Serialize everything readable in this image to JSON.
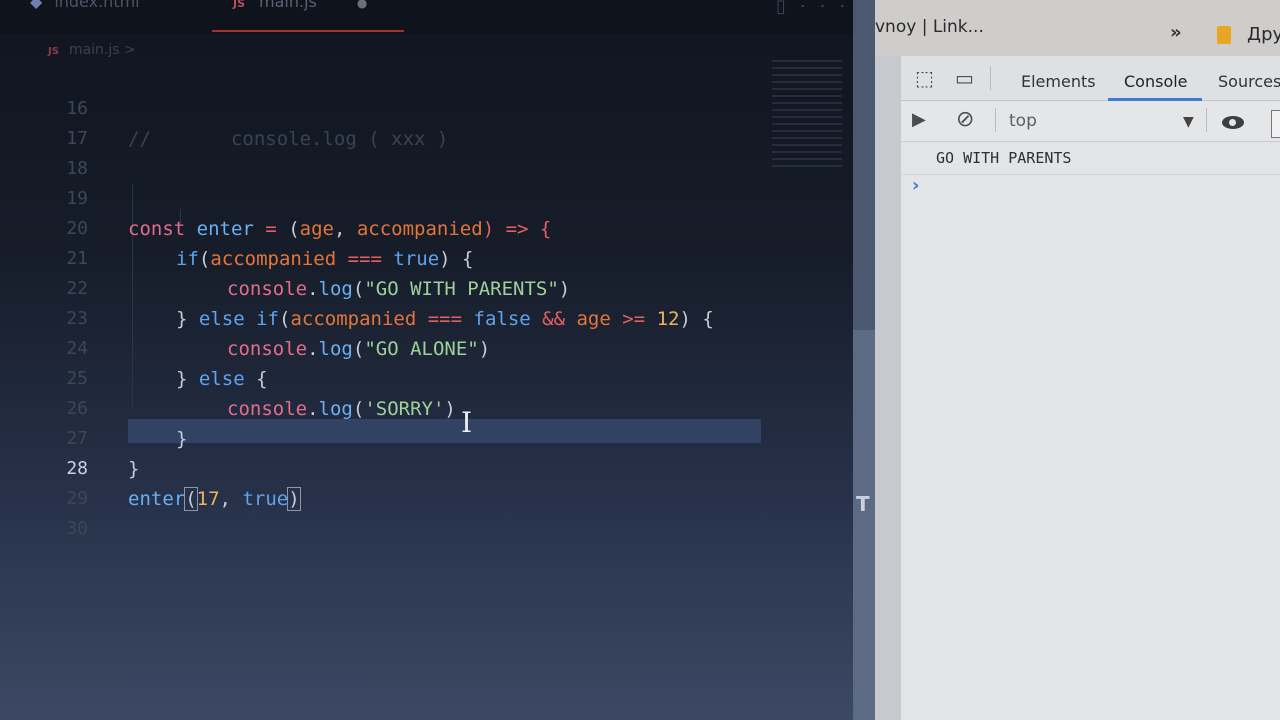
{
  "editor": {
    "tabs": [
      {
        "label": "index.html"
      },
      {
        "label": "main.js",
        "file_icon": "JS",
        "modified_indicator": "●"
      }
    ],
    "breadcrumb": {
      "file_icon": "JS",
      "label": "main.js >"
    },
    "toolbar_icons": {
      "split": "▯",
      "more": "···"
    },
    "current_line": "28",
    "lines": [
      {
        "n": "16",
        "text": "//       console.log ( xxx )"
      },
      {
        "n": "17",
        "text": ""
      },
      {
        "n": "18",
        "text": ""
      },
      {
        "n": "19",
        "text": "const enter = (age, accompanied) => {"
      },
      {
        "n": "20",
        "text": "    if(accompanied === true) {"
      },
      {
        "n": "21",
        "text": "        console.log(\"GO WITH PARENTS\")"
      },
      {
        "n": "22",
        "text": "    } else if(accompanied === false && age >= 12) {"
      },
      {
        "n": "23",
        "text": "        console.log(\"GO ALONE\")"
      },
      {
        "n": "24",
        "text": "    } else {"
      },
      {
        "n": "25",
        "text": "        console.log('SORRY')"
      },
      {
        "n": "26",
        "text": "    }"
      },
      {
        "n": "27",
        "text": "}"
      },
      {
        "n": "28",
        "text": "enter(17, true)"
      },
      {
        "n": "29",
        "text": ""
      },
      {
        "n": "30",
        "text": ""
      }
    ],
    "tokens": {
      "const": "const",
      "enter": "enter",
      "eq": " = ",
      "lp": "(",
      "age": "age",
      "comma": ", ",
      "accompanied": "accompanied",
      "arrow_open": ") => {",
      "if": "if",
      "strict_eq": " === ",
      "true": "true",
      "rp_brace": ") {",
      "console": "console",
      "dot_log": ".log",
      "log": "log",
      "dot": ".",
      "s_parents": "\"GO WITH PARENTS\"",
      "rp": ")",
      "close_else": "} ",
      "else": "else",
      "space": " ",
      "false": "false",
      "and": " && ",
      "gte": " >= ",
      "twelve": "12",
      "s_alone": "\"GO ALONE\"",
      "brace_open": " {",
      "s_sorry": "'SORRY'",
      "brace_close": "}",
      "seventeen": "17",
      "comment": "//       console.log ( xxx )"
    },
    "colors": {
      "keyword": "#5fa3ee",
      "string": "#9fd19a",
      "number": "#f0b35a",
      "param": "#e4753a",
      "const": "#e46d8b"
    }
  },
  "browser": {
    "tab_title": "vnoy | Link...",
    "overflow_chevron": "»",
    "bookmark_label": "Дру"
  },
  "devtools": {
    "tabs": [
      {
        "label": "Elements",
        "active": false
      },
      {
        "label": "Console",
        "active": true
      },
      {
        "label": "Sources",
        "active": false
      }
    ],
    "context": "top",
    "context_arrow": "▼",
    "console_output": [
      "GO WITH PARENTS"
    ],
    "prompt": "›",
    "icons": {
      "inspect": "⬚",
      "device": "▭",
      "run": "▶",
      "clear": "⊘"
    },
    "accent": "#3f7bd8"
  }
}
